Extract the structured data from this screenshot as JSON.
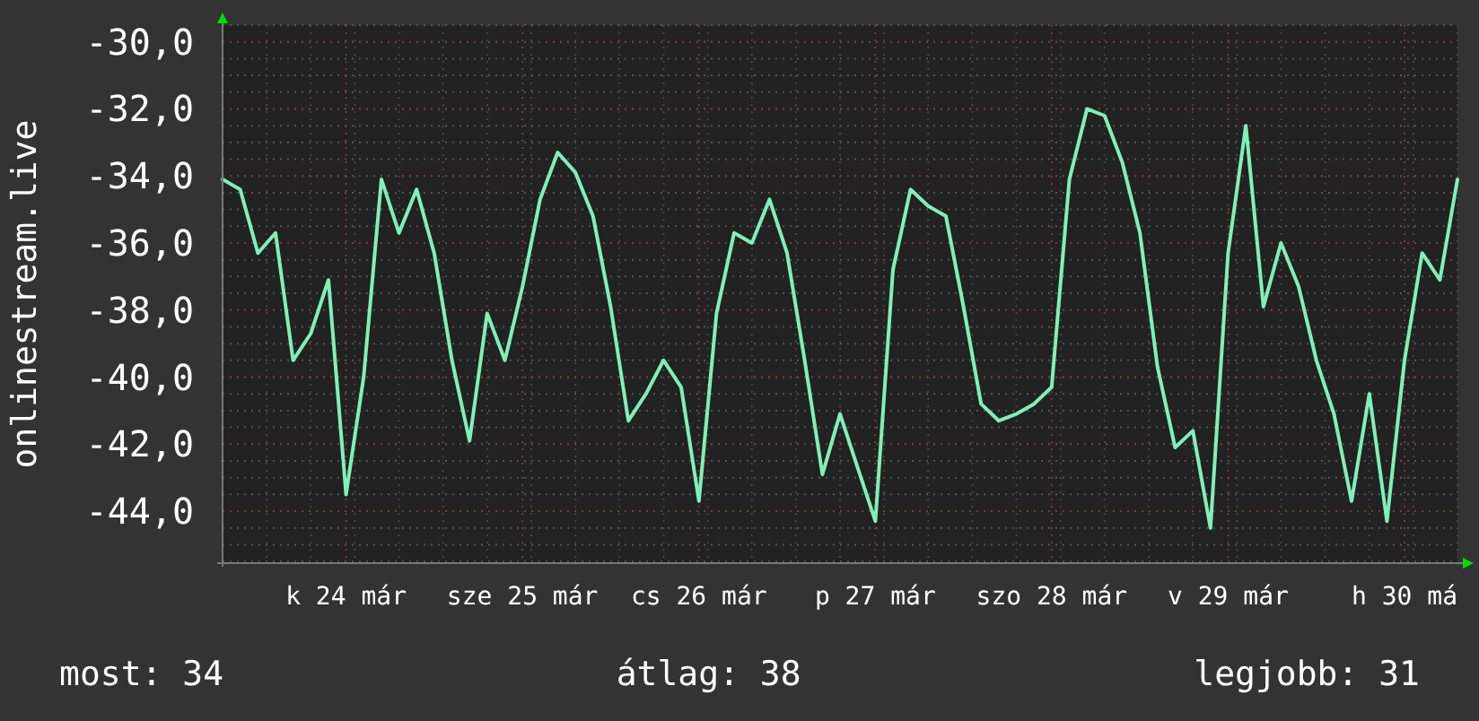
{
  "chart_data": {
    "type": "line",
    "ylabel": "onlinestream.live",
    "categories": [
      null,
      null,
      null,
      null,
      null,
      null,
      null,
      "k 24 már",
      null,
      null,
      null,
      null,
      null,
      null,
      null,
      null,
      null,
      "sze 25 már",
      null,
      null,
      null,
      null,
      null,
      null,
      null,
      null,
      null,
      "cs 26 már",
      null,
      null,
      null,
      null,
      null,
      null,
      null,
      null,
      null,
      "p 27 már",
      null,
      null,
      null,
      null,
      null,
      null,
      null,
      null,
      null,
      "szo 28 már",
      null,
      null,
      null,
      null,
      null,
      null,
      null,
      null,
      null,
      "v 29 már",
      null,
      null,
      null,
      null,
      null,
      null,
      null,
      null,
      null,
      "h 30 má",
      null,
      null,
      null
    ],
    "series": [
      {
        "color": "#7ff0b8",
        "values": [
          -34.1,
          -34.4,
          -36.3,
          -35.7,
          -39.5,
          -38.7,
          -37.1,
          -43.5,
          -40.0,
          -34.1,
          -35.7,
          -34.4,
          -36.3,
          -39.5,
          -41.9,
          -38.1,
          -39.5,
          -37.3,
          -34.7,
          -33.3,
          -33.9,
          -35.2,
          -37.9,
          -41.3,
          -40.5,
          -39.5,
          -40.3,
          -43.7,
          -38.1,
          -35.7,
          -36.0,
          -34.7,
          -36.3,
          -39.5,
          -42.9,
          -41.1,
          -42.7,
          -44.3,
          -36.8,
          -34.4,
          -34.9,
          -35.2,
          -37.9,
          -40.8,
          -41.3,
          -41.1,
          -40.8,
          -40.3,
          -34.1,
          -32.0,
          -32.2,
          -33.6,
          -35.7,
          -39.7,
          -42.1,
          -41.6,
          -44.5,
          -36.3,
          -32.5,
          -37.9,
          -36.0,
          -37.3,
          -39.5,
          -41.1,
          -43.7,
          -40.5,
          -44.3,
          -39.5,
          -36.3,
          -37.1,
          -34.1
        ]
      }
    ],
    "ylim": [
      -45.55,
      -29.5
    ],
    "grid": true,
    "yticks": [
      {
        "value": -30,
        "label": "-30,0"
      },
      {
        "value": -32,
        "label": "-32,0"
      },
      {
        "value": -34,
        "label": "-34,0"
      },
      {
        "value": -36,
        "label": "-36,0"
      },
      {
        "value": -38,
        "label": "-38,0"
      },
      {
        "value": -40,
        "label": "-40,0"
      },
      {
        "value": -42,
        "label": "-42,0"
      },
      {
        "value": -44,
        "label": "-44,0"
      }
    ]
  },
  "legend": [
    {
      "label": "most: 34"
    },
    {
      "label": "átlag: 38"
    },
    {
      "label": "legjobb: 31"
    }
  ]
}
